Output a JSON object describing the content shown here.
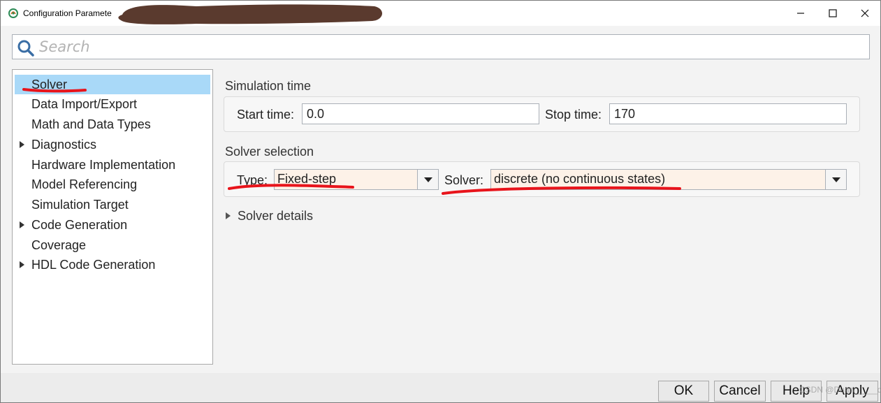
{
  "window": {
    "title": "Configuration Paramete",
    "controls": {
      "minimize": "—",
      "maximize": "☐",
      "close": "✕"
    }
  },
  "search": {
    "placeholder": "Search",
    "value": ""
  },
  "nav": {
    "items": [
      {
        "label": "Solver",
        "selected": true,
        "expandable": false
      },
      {
        "label": "Data Import/Export",
        "selected": false,
        "expandable": false
      },
      {
        "label": "Math and Data Types",
        "selected": false,
        "expandable": false
      },
      {
        "label": "Diagnostics",
        "selected": false,
        "expandable": true
      },
      {
        "label": "Hardware Implementation",
        "selected": false,
        "expandable": false
      },
      {
        "label": "Model Referencing",
        "selected": false,
        "expandable": false
      },
      {
        "label": "Simulation Target",
        "selected": false,
        "expandable": false
      },
      {
        "label": "Code Generation",
        "selected": false,
        "expandable": true
      },
      {
        "label": "Coverage",
        "selected": false,
        "expandable": false
      },
      {
        "label": "HDL Code Generation",
        "selected": false,
        "expandable": true
      }
    ]
  },
  "simulation_time": {
    "title": "Simulation time",
    "start_label": "Start time:",
    "start_value": "0.0",
    "stop_label": "Stop time:",
    "stop_value": "170"
  },
  "solver_selection": {
    "title": "Solver selection",
    "type_label": "Type:",
    "type_value": "Fixed-step",
    "solver_label": "Solver:",
    "solver_value": "discrete (no continuous states)"
  },
  "solver_details": {
    "label": "Solver details"
  },
  "buttons": {
    "ok": "OK",
    "cancel": "Cancel",
    "help": "Help",
    "apply": "Apply"
  },
  "watermark": "CSDN @Duan_____d",
  "colors": {
    "selection": "#a9d9f8",
    "combo_background": "#fdf2e8",
    "annotation_red": "#e8141b",
    "redaction": "#5a3a2e"
  }
}
